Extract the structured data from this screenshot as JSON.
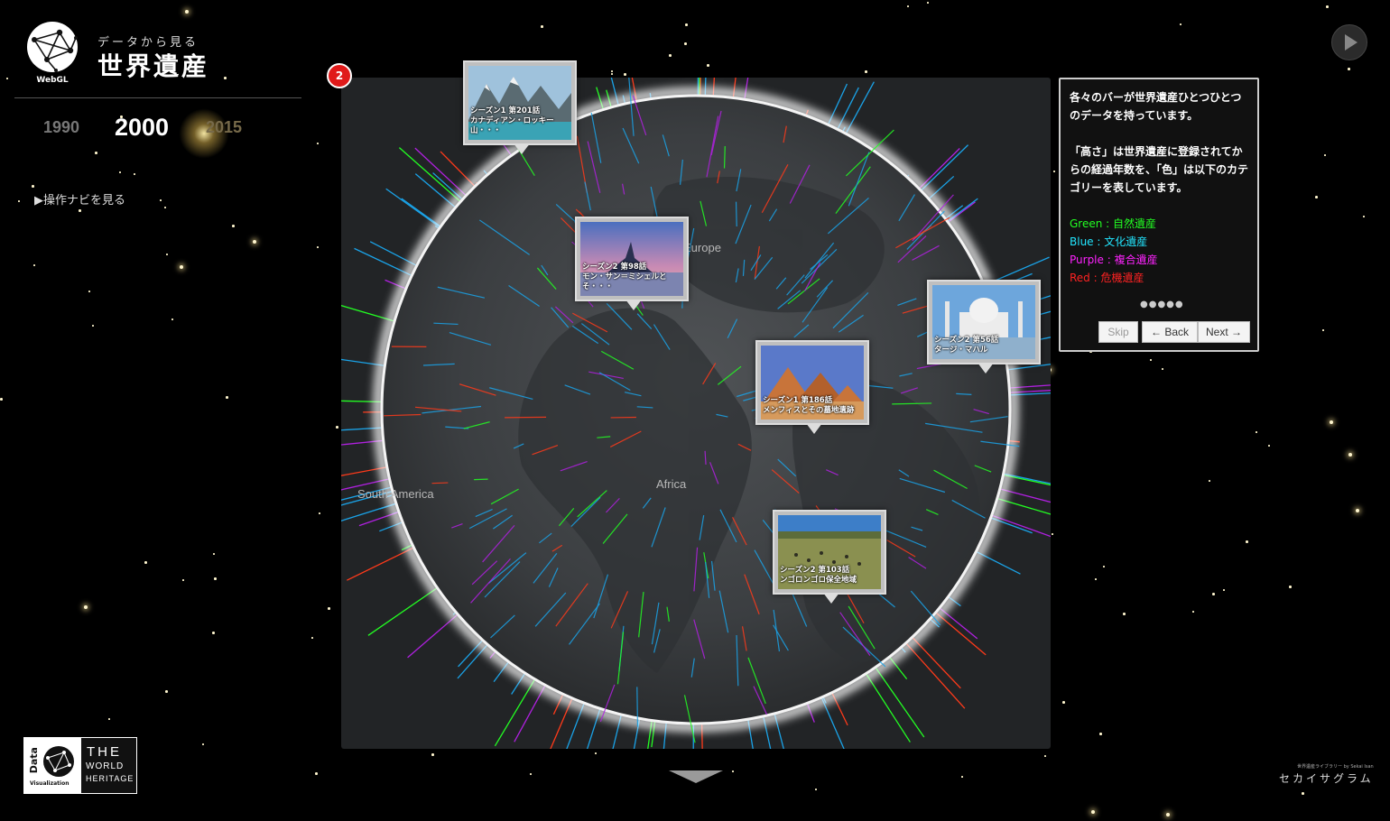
{
  "header": {
    "logo_caption": "WebGL",
    "subtitle": "データから見る",
    "title": "世界遺産"
  },
  "years": {
    "items": [
      "1990",
      "2000",
      "2015"
    ],
    "selected": "2000"
  },
  "nav_link": "▶操作ナビを見る",
  "globe": {
    "step_badge": "2",
    "continent_labels": {
      "europe": "Europe",
      "south_america": "South America",
      "africa": "Africa"
    }
  },
  "cards": [
    {
      "caption_line1": "シーズン1 第201話",
      "caption_line2": "カナディアン・ロッキー山・・・"
    },
    {
      "caption_line1": "シーズン2 第98話",
      "caption_line2": "モン・サン＝ミシェルとそ・・・"
    },
    {
      "caption_line1": "シーズン2 第56話",
      "caption_line2": "タージ・マハル"
    },
    {
      "caption_line1": "シーズン1 第186話",
      "caption_line2": "メンフィスとその墓地遺跡"
    },
    {
      "caption_line1": "シーズン2 第103話",
      "caption_line2": "ンゴロンゴロ保全地域"
    }
  ],
  "popover": {
    "paragraph1": "各々のバーが世界遺産ひとつひとつのデータを持っています。",
    "paragraph2": "「高さ」は世界遺産に登録されてからの経過年数を、「色」は以下のカテゴリーを表しています。",
    "legend": {
      "green": "Green : 自然遺産",
      "blue": "Blue : 文化遺産",
      "purple": "Purple : 複合遺産",
      "red": "Red : 危機遺産"
    },
    "dots": "●●●●●",
    "skip": "Skip",
    "back": "← Back",
    "next": "Next →"
  },
  "colors": {
    "green": "#22ff22",
    "blue": "#1aa3e8",
    "purple": "#b020e0",
    "red": "#ff3a1a",
    "badge": "#e01a1a"
  },
  "footer": {
    "logo_data": "Data",
    "logo_visualization": "Visualization",
    "logo_the": "THE",
    "logo_world": "WORLD",
    "logo_heritage": "HERITAGE",
    "brand_small": "世界遺産ライブラリー by Sekai Isan",
    "brand": "セカイサグラム"
  },
  "icons": {
    "play": "play-icon",
    "logo": "globe-network-icon",
    "scroll": "chevron-down-icon"
  }
}
